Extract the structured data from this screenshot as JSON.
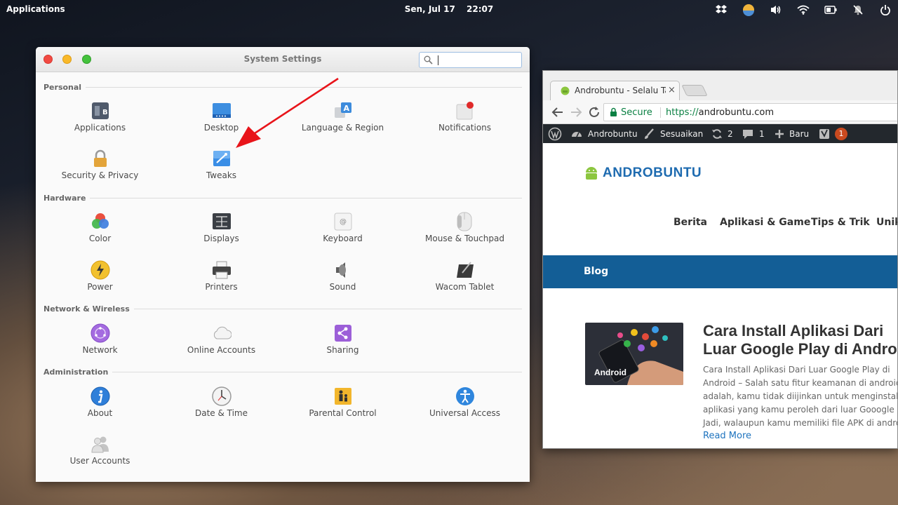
{
  "top_panel": {
    "applications_label": "Applications",
    "date": "Sen, Jul 17",
    "time": "22:07",
    "indicator_icons": [
      "dropbox-icon",
      "weather-icon",
      "volume-icon",
      "wifi-icon",
      "battery-icon",
      "notifications-off-icon",
      "power-icon"
    ]
  },
  "settings": {
    "title": "System Settings",
    "search_value": "",
    "sections": {
      "personal": "Personal",
      "hardware": "Hardware",
      "network": "Network & Wireless",
      "admin": "Administration"
    },
    "items": {
      "applications": "Applications",
      "desktop": "Desktop",
      "language": "Language & Region",
      "notifications": "Notifications",
      "security": "Security & Privacy",
      "tweaks": "Tweaks",
      "color": "Color",
      "displays": "Displays",
      "keyboard": "Keyboard",
      "mouse": "Mouse & Touchpad",
      "power": "Power",
      "printers": "Printers",
      "sound": "Sound",
      "wacom": "Wacom Tablet",
      "network": "Network",
      "online_accounts": "Online Accounts",
      "sharing": "Sharing",
      "about": "About",
      "datetime": "Date & Time",
      "parental": "Parental Control",
      "universal_access": "Universal Access",
      "user_accounts": "User Accounts"
    }
  },
  "browser": {
    "tab_title": "Androbuntu - Selalu Tahu",
    "tab_close": "×",
    "secure_label": "Secure",
    "url_scheme": "https://",
    "url_host": "androbuntu.com",
    "wp_bar": {
      "site_name": "Androbuntu",
      "customize": "Sesuaikan",
      "updates_count": "2",
      "comments_count": "1",
      "new_label": "Baru",
      "yoast_badge": "1"
    },
    "site": {
      "logo_text": "ANDROBUNTU",
      "nav": [
        "Berita",
        "Aplikasi & Game",
        "Tips & Trik",
        "Unik"
      ],
      "blog_label": "Blog",
      "post": {
        "category": "Android",
        "title_line1": "Cara Install Aplikasi Dari",
        "title_line2": "Luar Google Play di Android",
        "excerpt": [
          "Cara Install Aplikasi Dari Luar Google Play di",
          "Android – Salah satu fitur keamanan di android",
          "adalah, kamu tidak diijinkan untuk menginstall",
          "aplikasi yang kamu peroleh dari luar Gooogle Play.",
          "Jadi, walaupun kamu memiliki file APK di android"
        ],
        "read_more": "Read More"
      }
    }
  },
  "colors": {
    "wp_bar": "#23282d",
    "site_blue": "#135e96",
    "annotation_arrow": "#e8141a",
    "secure_green": "#0b8043"
  }
}
